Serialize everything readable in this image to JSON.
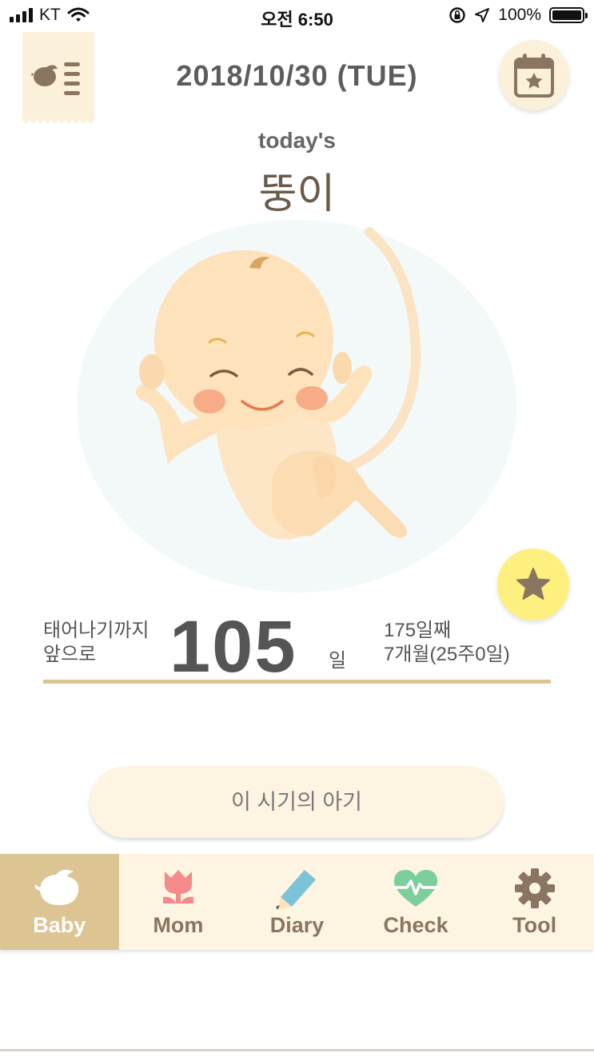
{
  "status_bar": {
    "carrier": "KT",
    "time": "오전 6:50",
    "battery_percent": "100%",
    "battery_level": 1.0
  },
  "header": {
    "date": "2018/10/30 (TUE)",
    "profile_icon": "bird-list-icon",
    "calendar_icon": "calendar-star-icon"
  },
  "hero": {
    "subtitle": "today's",
    "baby_name": "뚱이",
    "illustration": "fetus-illustration",
    "favorite_icon": "star-icon"
  },
  "countdown": {
    "label_line1": "태어나기까지",
    "label_line2": "앞으로",
    "days": "105",
    "unit": "일",
    "day_count": "175일째",
    "month_week": "7개월(25주0일)"
  },
  "action": {
    "label": "이 시기의 아기"
  },
  "tabs": [
    {
      "label": "Baby",
      "icon": "bird-icon",
      "active": true
    },
    {
      "label": "Mom",
      "icon": "tulip-icon",
      "active": false
    },
    {
      "label": "Diary",
      "icon": "pencil-icon",
      "active": false
    },
    {
      "label": "Check",
      "icon": "heart-pulse-icon",
      "active": false
    },
    {
      "label": "Tool",
      "icon": "gear-icon",
      "active": false
    }
  ],
  "colors": {
    "accent_gold": "#dcc493",
    "cream": "#fdf5e1",
    "star_yellow": "#fdf07f",
    "brown_icon": "#8a7560",
    "mom_pink": "#f58a8a",
    "diary_blue": "#7cc3d8",
    "check_green": "#7ccf9a"
  }
}
